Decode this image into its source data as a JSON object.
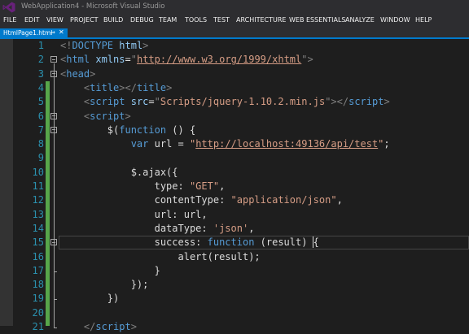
{
  "window": {
    "title": "WebApplication4 - Microsoft Visual Studio"
  },
  "menu": [
    "FILE",
    "EDIT",
    "VIEW",
    "PROJECT",
    "BUILD",
    "DEBUG",
    "TEAM",
    "TOOLS",
    "TEST",
    "ARCHITECTURE",
    "WEB ESSENTIALS",
    "ANALYZE",
    "WINDOW",
    "HELP"
  ],
  "tab": {
    "title": "HtmlPage1.html",
    "pin_glyph": "⇒",
    "close_glyph": "✕"
  },
  "colors": {
    "accent": "#007acc",
    "change_bar": "#57a64a",
    "line_number": "#2b91af",
    "keyword": "#569cd6",
    "string": "#d69d85"
  },
  "code": [
    {
      "n": "1",
      "tokens": [
        [
          "t-tag",
          "<!"
        ],
        [
          "t-name",
          "DOCTYPE"
        ],
        [
          "t-plain",
          " "
        ],
        [
          "t-attr",
          "html"
        ],
        [
          "t-tag",
          ">"
        ]
      ]
    },
    {
      "n": "2",
      "tokens": [
        [
          "t-tag",
          "<"
        ],
        [
          "t-name",
          "html"
        ],
        [
          "t-plain",
          " "
        ],
        [
          "t-attr",
          "xmlns"
        ],
        [
          "t-plain",
          "="
        ],
        [
          "t-tag",
          "\""
        ],
        [
          "t-url",
          "http://www.w3.org/1999/xhtml"
        ],
        [
          "t-tag",
          "\""
        ],
        [
          "t-tag",
          ">"
        ]
      ]
    },
    {
      "n": "3",
      "tokens": [
        [
          "t-tag",
          "<"
        ],
        [
          "t-name",
          "head"
        ],
        [
          "t-tag",
          ">"
        ]
      ]
    },
    {
      "n": "4",
      "tokens": [
        [
          "t-plain",
          "    "
        ],
        [
          "t-tag",
          "<"
        ],
        [
          "t-name",
          "title"
        ],
        [
          "t-tag",
          "></"
        ],
        [
          "t-name",
          "title"
        ],
        [
          "t-tag",
          ">"
        ]
      ]
    },
    {
      "n": "5",
      "tokens": [
        [
          "t-plain",
          "    "
        ],
        [
          "t-tag",
          "<"
        ],
        [
          "t-name",
          "script"
        ],
        [
          "t-plain",
          " "
        ],
        [
          "t-attr",
          "src"
        ],
        [
          "t-plain",
          "="
        ],
        [
          "t-tag",
          "\""
        ],
        [
          "t-str",
          "Scripts/jquery-1.10.2.min.js"
        ],
        [
          "t-tag",
          "\""
        ],
        [
          "t-tag",
          "></"
        ],
        [
          "t-name",
          "script"
        ],
        [
          "t-tag",
          ">"
        ]
      ]
    },
    {
      "n": "6",
      "tokens": [
        [
          "t-plain",
          "    "
        ],
        [
          "t-tag",
          "<"
        ],
        [
          "t-name",
          "script"
        ],
        [
          "t-tag",
          ">"
        ]
      ]
    },
    {
      "n": "7",
      "tokens": [
        [
          "t-plain",
          "        $("
        ],
        [
          "t-kw",
          "function"
        ],
        [
          "t-plain",
          " () {"
        ]
      ]
    },
    {
      "n": "8",
      "tokens": [
        [
          "t-plain",
          "            "
        ],
        [
          "t-kw",
          "var"
        ],
        [
          "t-plain",
          " url = "
        ],
        [
          "t-str",
          "\""
        ],
        [
          "t-url",
          "http://localhost:49136/api/test"
        ],
        [
          "t-str",
          "\""
        ],
        [
          "t-plain",
          ";"
        ]
      ]
    },
    {
      "n": "9",
      "tokens": []
    },
    {
      "n": "10",
      "tokens": [
        [
          "t-plain",
          "            $.ajax({"
        ]
      ]
    },
    {
      "n": "11",
      "tokens": [
        [
          "t-plain",
          "                type: "
        ],
        [
          "t-str",
          "\"GET\""
        ],
        [
          "t-plain",
          ","
        ]
      ]
    },
    {
      "n": "12",
      "tokens": [
        [
          "t-plain",
          "                contentType: "
        ],
        [
          "t-str",
          "\"application/json\""
        ],
        [
          "t-plain",
          ","
        ]
      ]
    },
    {
      "n": "13",
      "tokens": [
        [
          "t-plain",
          "                url: url,"
        ]
      ]
    },
    {
      "n": "14",
      "tokens": [
        [
          "t-plain",
          "                dataType: "
        ],
        [
          "t-str",
          "'json'"
        ],
        [
          "t-plain",
          ","
        ]
      ]
    },
    {
      "n": "15",
      "tokens": [
        [
          "t-plain",
          "                success: "
        ],
        [
          "t-kw",
          "function"
        ],
        [
          "t-plain",
          " (result) {"
        ]
      ]
    },
    {
      "n": "16",
      "tokens": [
        [
          "t-plain",
          "                    alert(result);"
        ]
      ]
    },
    {
      "n": "17",
      "tokens": [
        [
          "t-plain",
          "                }"
        ]
      ]
    },
    {
      "n": "18",
      "tokens": [
        [
          "t-plain",
          "            });"
        ]
      ]
    },
    {
      "n": "19",
      "tokens": [
        [
          "t-plain",
          "        })"
        ]
      ]
    },
    {
      "n": "20",
      "tokens": []
    },
    {
      "n": "21",
      "tokens": [
        [
          "t-plain",
          "    "
        ],
        [
          "t-tag",
          "</"
        ],
        [
          "t-name",
          "script"
        ],
        [
          "t-tag",
          ">"
        ]
      ]
    }
  ]
}
